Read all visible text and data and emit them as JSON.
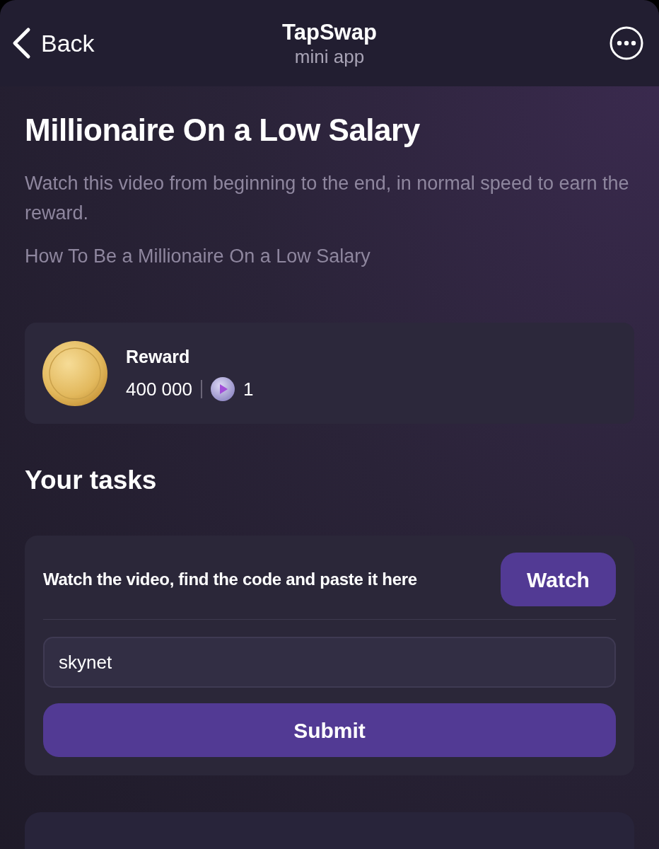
{
  "header": {
    "back": {
      "label": "Back"
    },
    "title": "TapSwap",
    "subtitle": "mini app"
  },
  "mission": {
    "title": "Millionaire On a Low Salary",
    "description": "Watch this video from beginning to the end, in normal speed to earn the reward.",
    "video_title": "How To Be a Millionaire On a Low Salary"
  },
  "reward": {
    "label": "Reward",
    "coins": "400 000",
    "tickets": "1"
  },
  "tasks": {
    "heading": "Your tasks",
    "items": [
      {
        "kind": "code",
        "instruction": "Watch the video, find the code and paste it here",
        "action": "Watch",
        "input": {
          "value": "skynet"
        },
        "submit": "Submit"
      }
    ]
  }
}
